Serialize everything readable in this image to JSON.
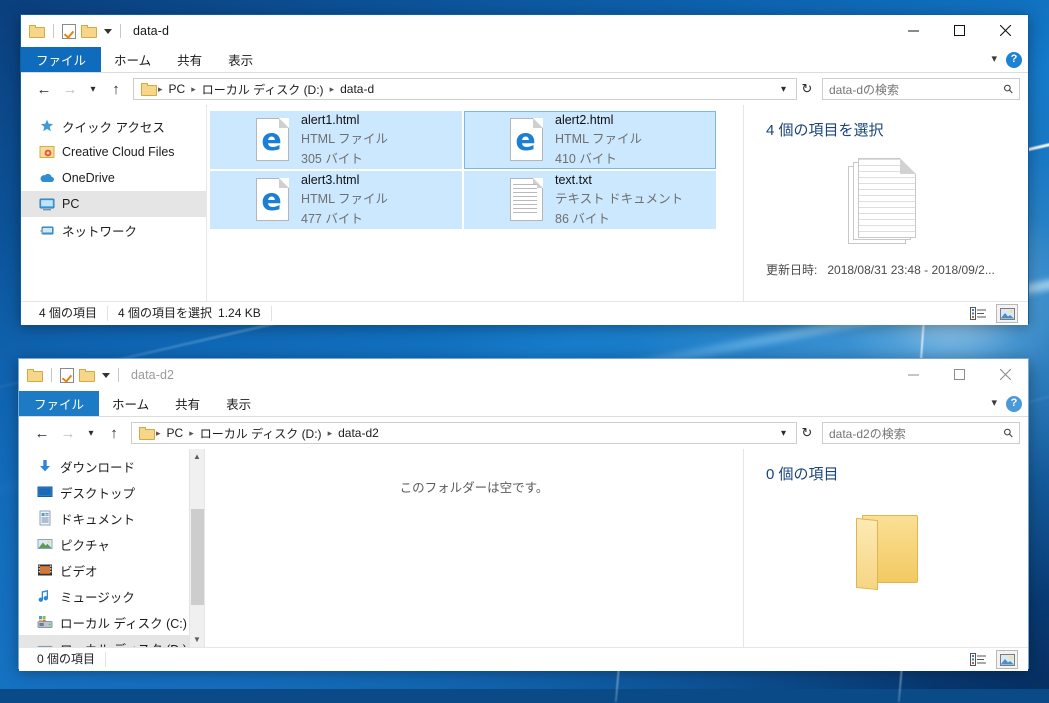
{
  "windows": [
    {
      "title": "data-d",
      "tabs": [
        "ファイル",
        "ホーム",
        "共有",
        "表示"
      ],
      "breadcrumb": [
        "PC",
        "ローカル ディスク (D:)",
        "data-d"
      ],
      "search_placeholder": "data-dの検索",
      "nav_items": [
        {
          "label": "クイック アクセス",
          "icon": "star-icon",
          "selected": false
        },
        {
          "label": "Creative Cloud Files",
          "icon": "creative-cloud-icon",
          "selected": false
        },
        {
          "label": "OneDrive",
          "icon": "onedrive-cloud-icon",
          "selected": false
        },
        {
          "label": "PC",
          "icon": "this-pc-icon",
          "selected": true
        },
        {
          "label": "ネットワーク",
          "icon": "network-icon",
          "selected": false
        }
      ],
      "files": [
        {
          "name": "alert1.html",
          "type": "HTML ファイル",
          "size": "305 バイト",
          "icon": "edge-html-icon",
          "selected": true,
          "focused": false
        },
        {
          "name": "alert2.html",
          "type": "HTML ファイル",
          "size": "410 バイト",
          "icon": "edge-html-icon",
          "selected": true,
          "focused": true
        },
        {
          "name": "alert3.html",
          "type": "HTML ファイル",
          "size": "477 バイト",
          "icon": "edge-html-icon",
          "selected": true,
          "focused": false
        },
        {
          "name": "text.txt",
          "type": "テキスト ドキュメント",
          "size": "86 バイト",
          "icon": "text-document-icon",
          "selected": true,
          "focused": false
        }
      ],
      "details": {
        "heading": "4 個の項目を選択",
        "icon": "stacked-documents-icon",
        "meta_key": "更新日時:",
        "meta_value": "2018/08/31 23:48 - 2018/09/2..."
      },
      "status": {
        "items": [
          "4 個の項目",
          "4 個の項目を選択",
          "1.24 KB"
        ]
      }
    },
    {
      "title": "data-d2",
      "tabs": [
        "ファイル",
        "ホーム",
        "共有",
        "表示"
      ],
      "breadcrumb": [
        "PC",
        "ローカル ディスク (D:)",
        "data-d2"
      ],
      "search_placeholder": "data-d2の検索",
      "nav_items": [
        {
          "label": "ダウンロード",
          "icon": "downloads-icon",
          "selected": false
        },
        {
          "label": "デスクトップ",
          "icon": "desktop-icon",
          "selected": false
        },
        {
          "label": "ドキュメント",
          "icon": "documents-icon",
          "selected": false
        },
        {
          "label": "ピクチャ",
          "icon": "pictures-icon",
          "selected": false
        },
        {
          "label": "ビデオ",
          "icon": "videos-icon",
          "selected": false
        },
        {
          "label": "ミュージック",
          "icon": "music-icon",
          "selected": false
        },
        {
          "label": "ローカル ディスク (C:)",
          "icon": "system-drive-icon",
          "selected": false
        },
        {
          "label": "ローカル ディスク (D:)",
          "icon": "drive-icon",
          "selected": true
        }
      ],
      "empty_message": "このフォルダーは空です。",
      "details": {
        "heading": "0 個の項目",
        "icon": "open-folder-icon"
      },
      "status": {
        "items": [
          "0 個の項目"
        ]
      }
    }
  ],
  "window_controls": {
    "minimize": "minimize-button",
    "maximize": "maximize-button",
    "close": "close-button"
  },
  "colors": {
    "accent": "#0f6cbd",
    "selection": "#cce8ff",
    "focus_border": "#7cb7e8",
    "title_text": "#1a1a1a"
  }
}
